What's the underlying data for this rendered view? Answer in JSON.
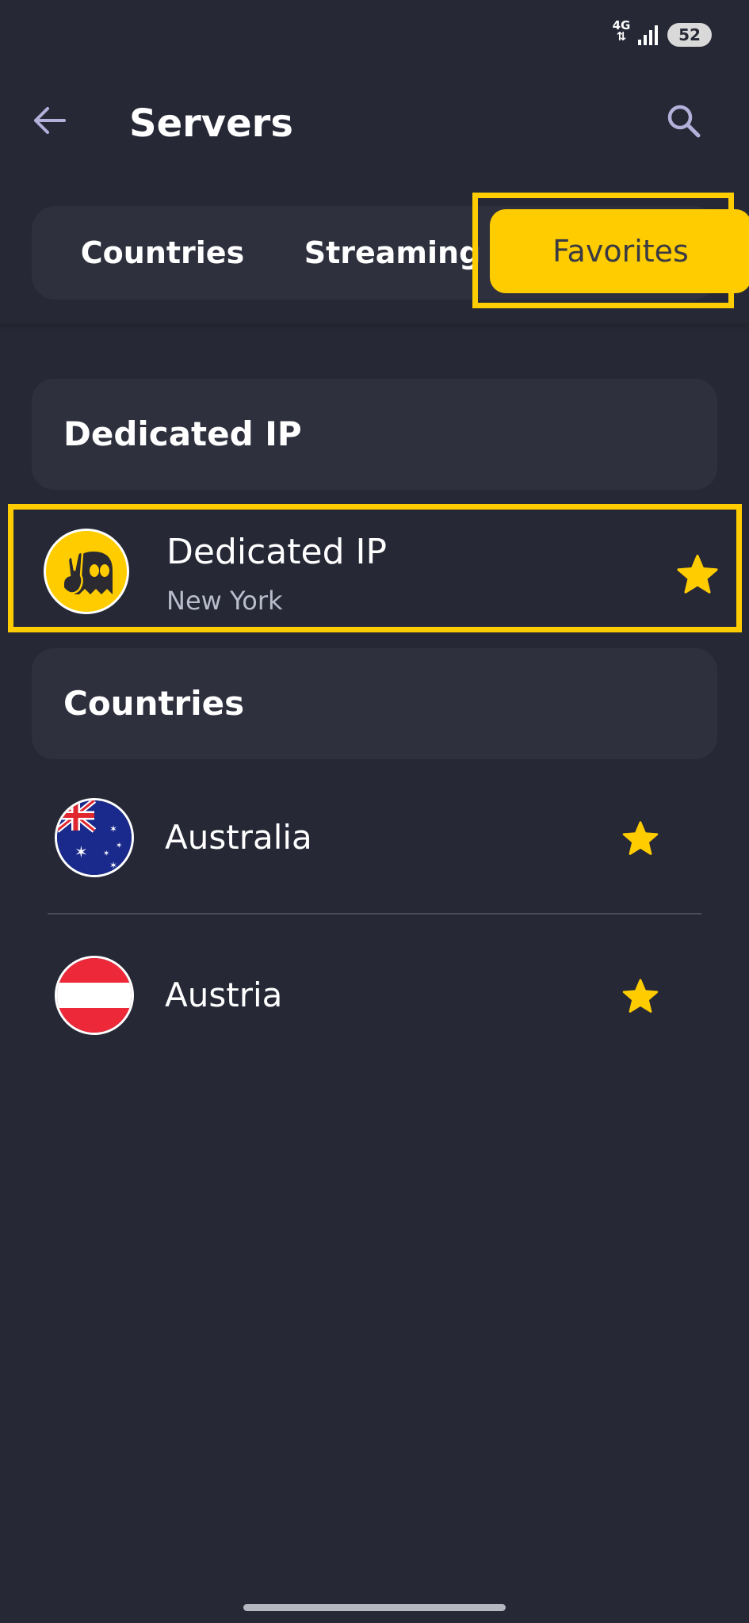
{
  "status_bar": {
    "network": "4G",
    "battery": "52"
  },
  "header": {
    "title": "Servers"
  },
  "tabs": [
    {
      "label": "Countries",
      "selected": false
    },
    {
      "label": "Streaming",
      "selected": false
    },
    {
      "label": "Favorites",
      "selected": true
    }
  ],
  "sections": {
    "dedicated": {
      "title": "Dedicated IP",
      "item": {
        "name": "Dedicated IP",
        "location": "New York",
        "favorite": true,
        "icon": "ghost-peace-icon"
      }
    },
    "countries": {
      "title": "Countries",
      "items": [
        {
          "name": "Australia",
          "flag": "australia-flag-icon",
          "favorite": true
        },
        {
          "name": "Austria",
          "flag": "austria-flag-icon",
          "favorite": true
        }
      ]
    }
  },
  "colors": {
    "background": "#262836",
    "card": "#2e303e",
    "accent": "#ffcc00",
    "secondary_text": "#b9bccb"
  }
}
